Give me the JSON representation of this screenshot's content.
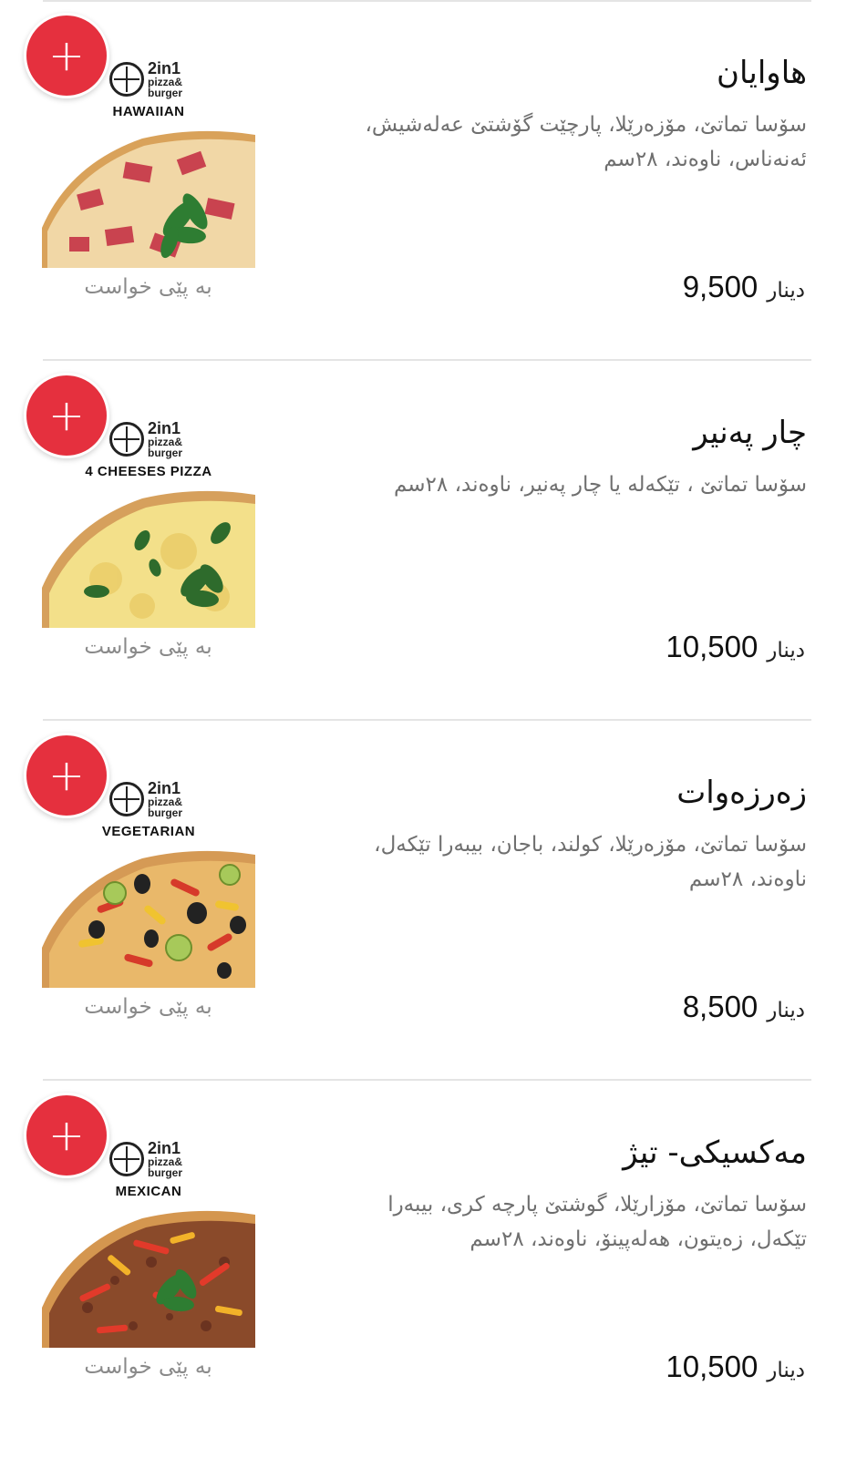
{
  "menu": {
    "add_symbol": "+",
    "items": [
      {
        "title": "هاوایان",
        "description": "سۆسا تماتێ، مۆزەرێلا، پارچێت گۆشتێ عەلەشیش، ئەنەناس، ناوەند، ٢٨سم",
        "price_amount": "9,500",
        "price_currency": "دینار",
        "request_note": "بە پێی خواست",
        "image": {
          "brand": "2in1",
          "brand_sub": "pizza&",
          "brand_sub2": "burger",
          "pizza_name": "HAWAIIAN",
          "icon": "hawaiian-pizza"
        }
      },
      {
        "title": "چار پەنیر",
        "description": "سۆسا تماتێ ، تێکەلە یا چار پەنیر، ناوەند، ٢٨سم",
        "price_amount": "10,500",
        "price_currency": "دینار",
        "request_note": "بە پێی خواست",
        "image": {
          "brand": "2in1",
          "brand_sub": "pizza&",
          "brand_sub2": "burger",
          "pizza_name": "4 CHEESES PIZZA",
          "icon": "cheese-pizza"
        }
      },
      {
        "title": "زەرزەوات",
        "description": "سۆسا تماتێ، مۆزەرێلا، کولند، باجان، بیبەرا تێکەل، ناوەند، ٢٨سم",
        "price_amount": "8,500",
        "price_currency": "دینار",
        "request_note": "بە پێی خواست",
        "image": {
          "brand": "2in1",
          "brand_sub": "pizza&",
          "brand_sub2": "burger",
          "pizza_name": "VEGETARIAN",
          "icon": "vegetarian-pizza"
        }
      },
      {
        "title": "مەکسیکی- تیژ",
        "description": "سۆسا تماتێ، مۆزارێلا، گوشتێ پارچە کری، بیبەرا تێکەل، زەیتون، هەلەپینۆ، ناوەند، ٢٨سم",
        "price_amount": "10,500",
        "price_currency": "دینار",
        "request_note": "بە پێی خواست",
        "image": {
          "brand": "2in1",
          "brand_sub": "pizza&",
          "brand_sub2": "burger",
          "pizza_name": "MEXICAN",
          "icon": "mexican-pizza"
        }
      }
    ]
  },
  "colors": {
    "accent": "#e5303e",
    "price_text": "#111111",
    "description_text": "#6f6f6f",
    "note_text": "#8a8a8a",
    "divider": "#e4e4e4"
  }
}
